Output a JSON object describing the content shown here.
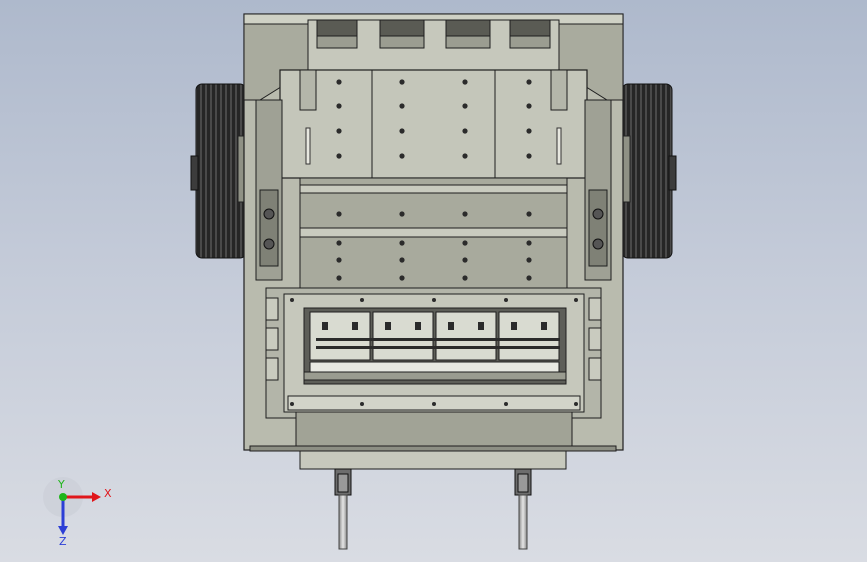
{
  "viewport": {
    "background_top": "#aeb9cc",
    "background_bottom": "#d9dce3",
    "body_color": "#bdbfb3",
    "plate_color": "#a7aa9c",
    "dark_color": "#2a2a2a",
    "edge_color": "#1e1e1e"
  },
  "triad": {
    "x_label": "X",
    "y_label": "Y",
    "z_label": "Z",
    "x_color": "#e0161b",
    "y_color": "#1fb51a",
    "z_color": "#2c3fd6"
  }
}
